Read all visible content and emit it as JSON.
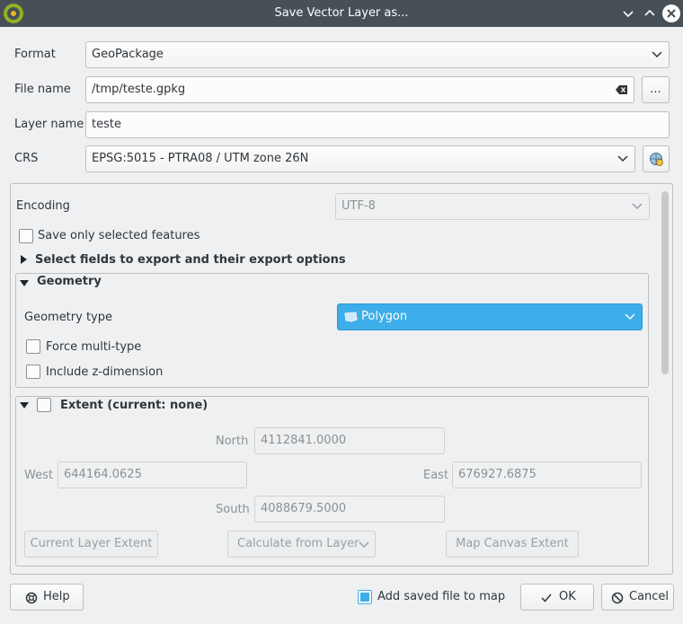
{
  "window": {
    "title": "Save Vector Layer as..."
  },
  "form": {
    "format_label": "Format",
    "format_value": "GeoPackage",
    "filename_label": "File name",
    "filename_value": "/tmp/teste.gpkg",
    "browse_label": "...",
    "layername_label": "Layer name",
    "layername_value": "teste",
    "crs_label": "CRS",
    "crs_value": "EPSG:5015 - PTRA08 / UTM zone 26N"
  },
  "options": {
    "encoding_label": "Encoding",
    "encoding_value": "UTF-8",
    "save_selected_label": "Save only selected features",
    "save_selected_checked": false,
    "select_fields_label": "Select fields to export and their export options"
  },
  "geometry": {
    "title": "Geometry",
    "type_label": "Geometry type",
    "type_value": "Polygon",
    "force_multi_label": "Force multi-type",
    "include_z_label": "Include z-dimension"
  },
  "extent": {
    "title": "Extent (current: none)",
    "north_label": "North",
    "north_value": "4112841.0000",
    "west_label": "West",
    "west_value": "644164.0625",
    "east_label": "East",
    "east_value": "676927.6875",
    "south_label": "South",
    "south_value": "4088679.5000",
    "current_layer_btn": "Current Layer Extent",
    "calc_from_layer_btn": "Calculate from Layer",
    "map_canvas_btn": "Map Canvas Extent"
  },
  "footer": {
    "help_label": "Help",
    "add_to_map_label": "Add saved file to map",
    "add_to_map_checked": true,
    "ok_label": "OK",
    "cancel_label": "Cancel"
  },
  "colors": {
    "accent": "#3daee9",
    "titlebar": "#475057",
    "background": "#eff0f1"
  }
}
